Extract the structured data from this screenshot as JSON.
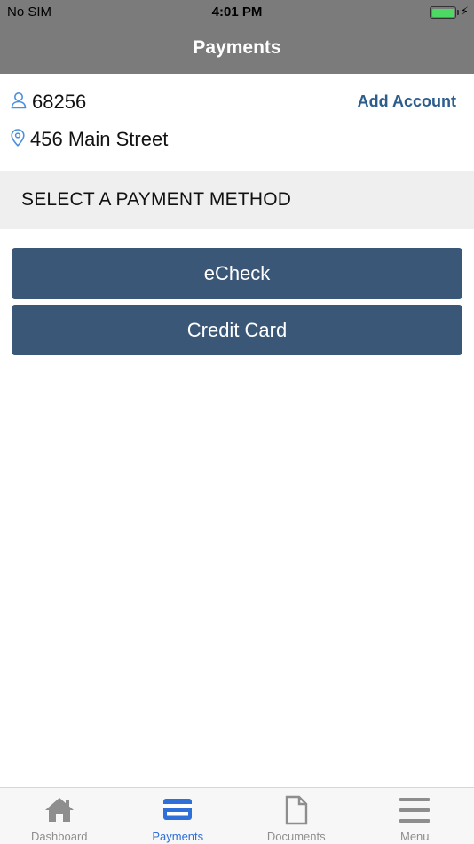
{
  "status_bar": {
    "carrier": "No SIM",
    "time": "4:01 PM",
    "battery_color": "#4cd964"
  },
  "nav": {
    "title": "Payments"
  },
  "account": {
    "number": "68256",
    "address": "456 Main Street",
    "add_account_label": "Add Account",
    "account_icon": "person-icon",
    "address_icon": "location-pin-icon"
  },
  "section": {
    "header": "SELECT A PAYMENT METHOD"
  },
  "buttons": {
    "echeck": "eCheck",
    "credit_card": "Credit Card",
    "color": "#3a5778"
  },
  "tabs": [
    {
      "label": "Dashboard",
      "icon": "home-icon",
      "active": false
    },
    {
      "label": "Payments",
      "icon": "credit-card-icon",
      "active": true
    },
    {
      "label": "Documents",
      "icon": "document-icon",
      "active": false
    },
    {
      "label": "Menu",
      "icon": "hamburger-menu-icon",
      "active": false
    }
  ],
  "colors": {
    "accent": "#2f6fd8",
    "link": "#2d5d8c",
    "header_bg": "#7b7b7b"
  }
}
